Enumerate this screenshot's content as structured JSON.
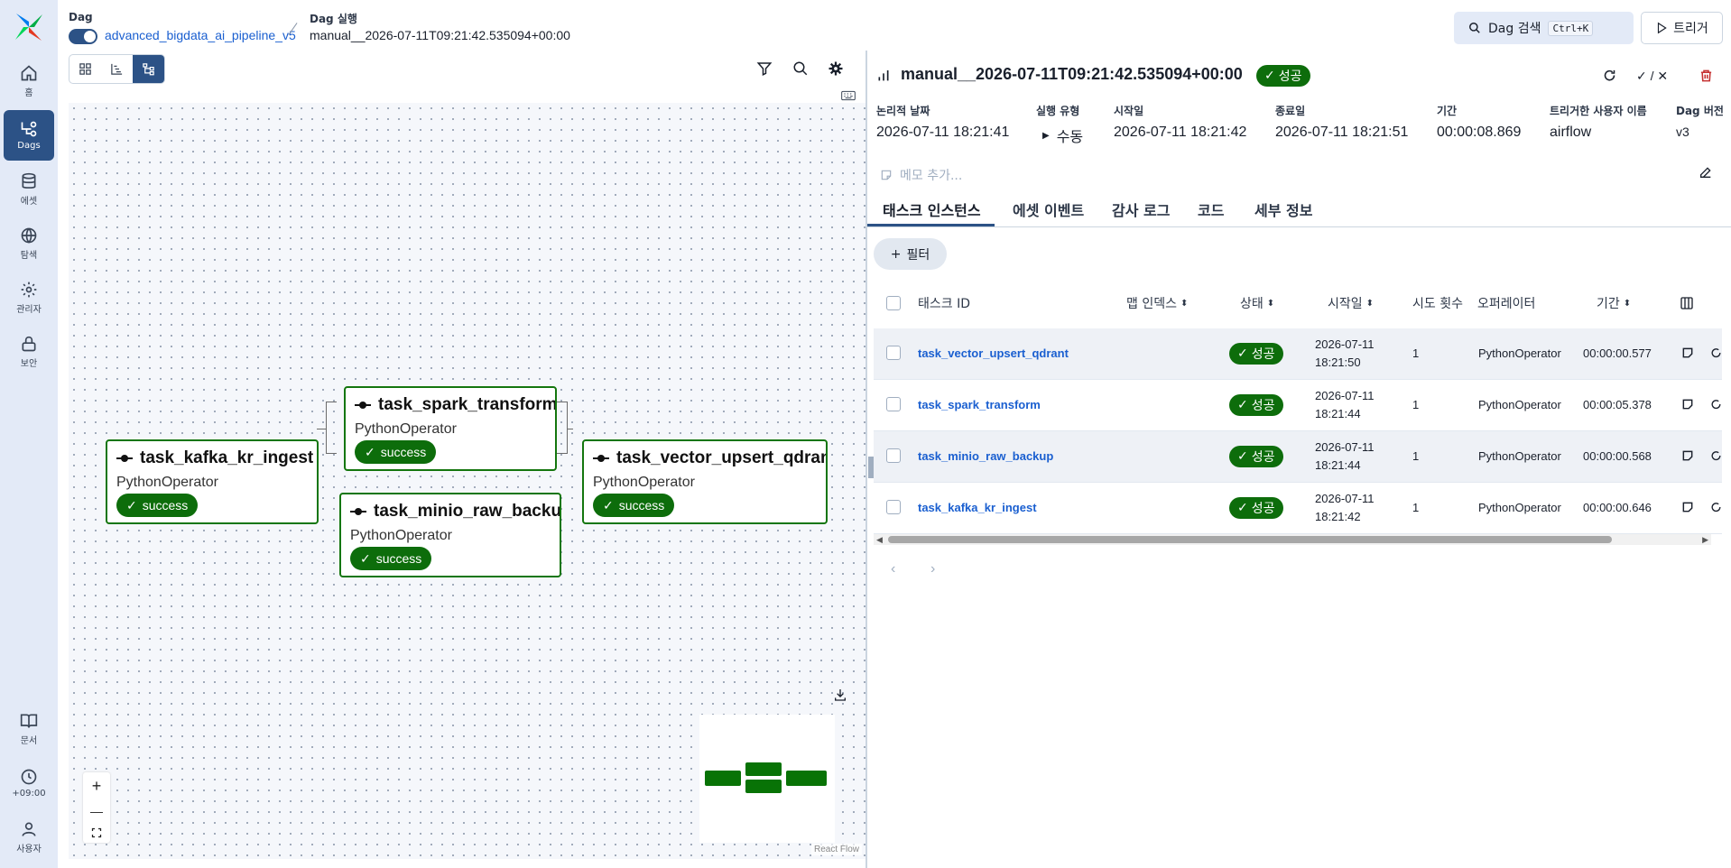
{
  "colors": {
    "accent": "#2c5286",
    "success": "#0d6d0b",
    "link": "#1a5fd0",
    "sidebar_bg": "#e3eaf7"
  },
  "sidebar": {
    "logo": "airflow-pinwheel-icon",
    "items": [
      {
        "label": "홈",
        "icon": "home-icon"
      },
      {
        "label": "Dags",
        "icon": "dags-icon",
        "active": true
      },
      {
        "label": "에셋",
        "icon": "database-icon"
      },
      {
        "label": "탐색",
        "icon": "globe-icon"
      },
      {
        "label": "관리자",
        "icon": "gear-icon"
      },
      {
        "label": "보안",
        "icon": "lock-icon"
      }
    ],
    "bottom_items": [
      {
        "label": "문서",
        "icon": "book-icon"
      },
      {
        "label": "+09:00",
        "icon": "clock-icon"
      },
      {
        "label": "사용자",
        "icon": "user-icon"
      }
    ]
  },
  "header": {
    "dag_label": "Dag",
    "dag_name": "advanced_bigdata_ai_pipeline_v5",
    "run_label": "Dag 실행",
    "run_id": "manual__2026-07-11T09:21:42.535094+00:00",
    "search_label": "Dag 검색",
    "search_shortcut": "Ctrl+K",
    "trigger_label": "트리거"
  },
  "graph": {
    "nodes": [
      {
        "id": "task_kafka_kr_ingest",
        "operator": "PythonOperator",
        "state": "success"
      },
      {
        "id": "task_spark_transform",
        "operator": "PythonOperator",
        "state": "success"
      },
      {
        "id": "task_minio_raw_backup",
        "operator": "PythonOperator",
        "state": "success"
      },
      {
        "id": "task_vector_upsert_qdrant",
        "operator": "PythonOperator",
        "state": "success"
      }
    ],
    "zoom_in": "+",
    "zoom_out": "—",
    "attribution": "React Flow"
  },
  "run": {
    "title": "manual__2026-07-11T09:21:42.535094+00:00",
    "status": "성공",
    "meta": [
      {
        "label": "논리적 날짜",
        "value": "2026-07-11 18:21:41"
      },
      {
        "label": "실행 유형",
        "value": "수동"
      },
      {
        "label": "시작일",
        "value": "2026-07-11 18:21:42"
      },
      {
        "label": "종료일",
        "value": "2026-07-11 18:21:51"
      },
      {
        "label": "기간",
        "value": "00:00:08.869"
      },
      {
        "label": "트리거한 사용자 이름",
        "value": "airflow"
      },
      {
        "label": "Dag 버전",
        "value": "v3"
      }
    ],
    "memo_placeholder": "메모 추가...",
    "check_x": "✓ / ✕"
  },
  "tabs": [
    "태스크 인스턴스",
    "에셋 이벤트",
    "감사 로그",
    "코드",
    "세부 정보"
  ],
  "filter_label": "필터",
  "table": {
    "columns": [
      "태스크 ID",
      "맵 인덱스",
      "상태",
      "시작일",
      "시도 횟수",
      "오퍼레이터",
      "기간"
    ],
    "rows": [
      {
        "task_id": "task_vector_upsert_qdrant",
        "state": "성공",
        "date": "2026-07-11",
        "time": "18:21:50",
        "tries": "1",
        "operator": "PythonOperator",
        "duration": "00:00:00.577"
      },
      {
        "task_id": "task_spark_transform",
        "state": "성공",
        "date": "2026-07-11",
        "time": "18:21:44",
        "tries": "1",
        "operator": "PythonOperator",
        "duration": "00:00:05.378"
      },
      {
        "task_id": "task_minio_raw_backup",
        "state": "성공",
        "date": "2026-07-11",
        "time": "18:21:44",
        "tries": "1",
        "operator": "PythonOperator",
        "duration": "00:00:00.568"
      },
      {
        "task_id": "task_kafka_kr_ingest",
        "state": "성공",
        "date": "2026-07-11",
        "time": "18:21:42",
        "tries": "1",
        "operator": "PythonOperator",
        "duration": "00:00:00.646"
      }
    ]
  },
  "pager": {
    "prev": "‹",
    "next": "›"
  }
}
